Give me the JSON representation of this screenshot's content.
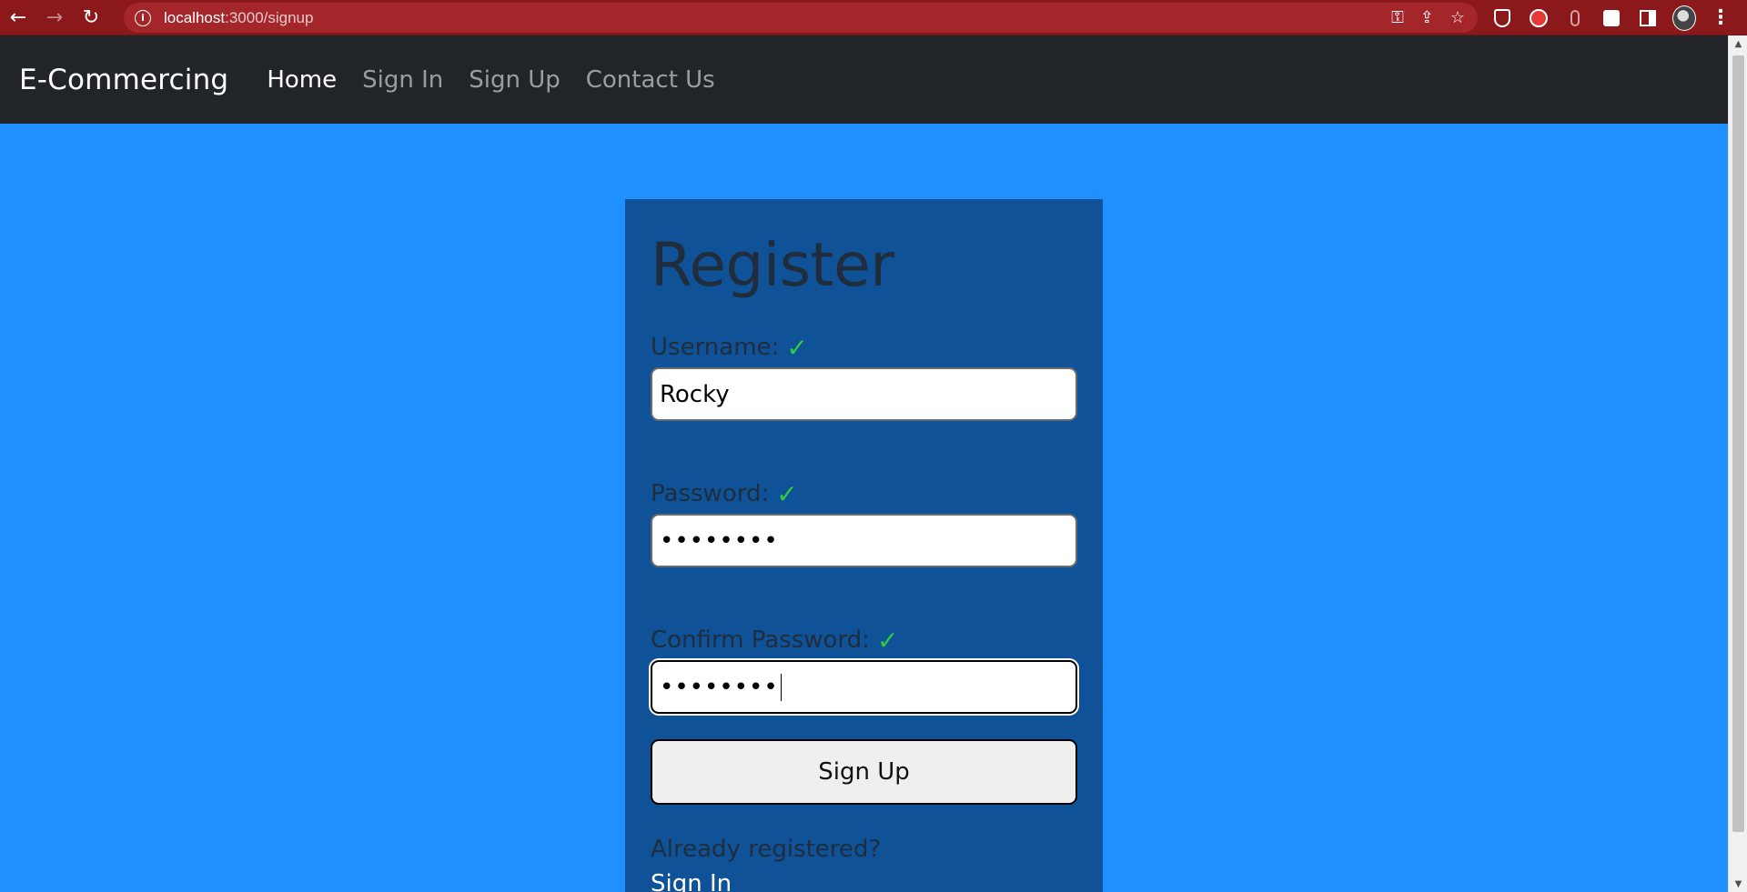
{
  "browser": {
    "url_host": "localhost",
    "url_path": ":3000/signup"
  },
  "navbar": {
    "brand": "E-Commercing",
    "links": [
      {
        "label": "Home",
        "active": true
      },
      {
        "label": "Sign In",
        "active": false
      },
      {
        "label": "Sign Up",
        "active": false
      },
      {
        "label": "Contact Us",
        "active": false
      }
    ]
  },
  "form": {
    "title": "Register",
    "username_label": "Username:",
    "username_value": "Rocky",
    "password_label": "Password:",
    "password_value": "••••••••",
    "confirm_label": "Confirm Password:",
    "confirm_value": "••••••••",
    "submit_label": "Sign Up",
    "already_text": "Already registered?",
    "signin_link": "Sign In",
    "check_glyph": "✓"
  },
  "colors": {
    "page_bg": "#1e90ff",
    "card_bg": "#0f5298",
    "navbar_bg": "#212529",
    "browser_bar": "#8b181b",
    "check_green": "#2ecc40"
  }
}
